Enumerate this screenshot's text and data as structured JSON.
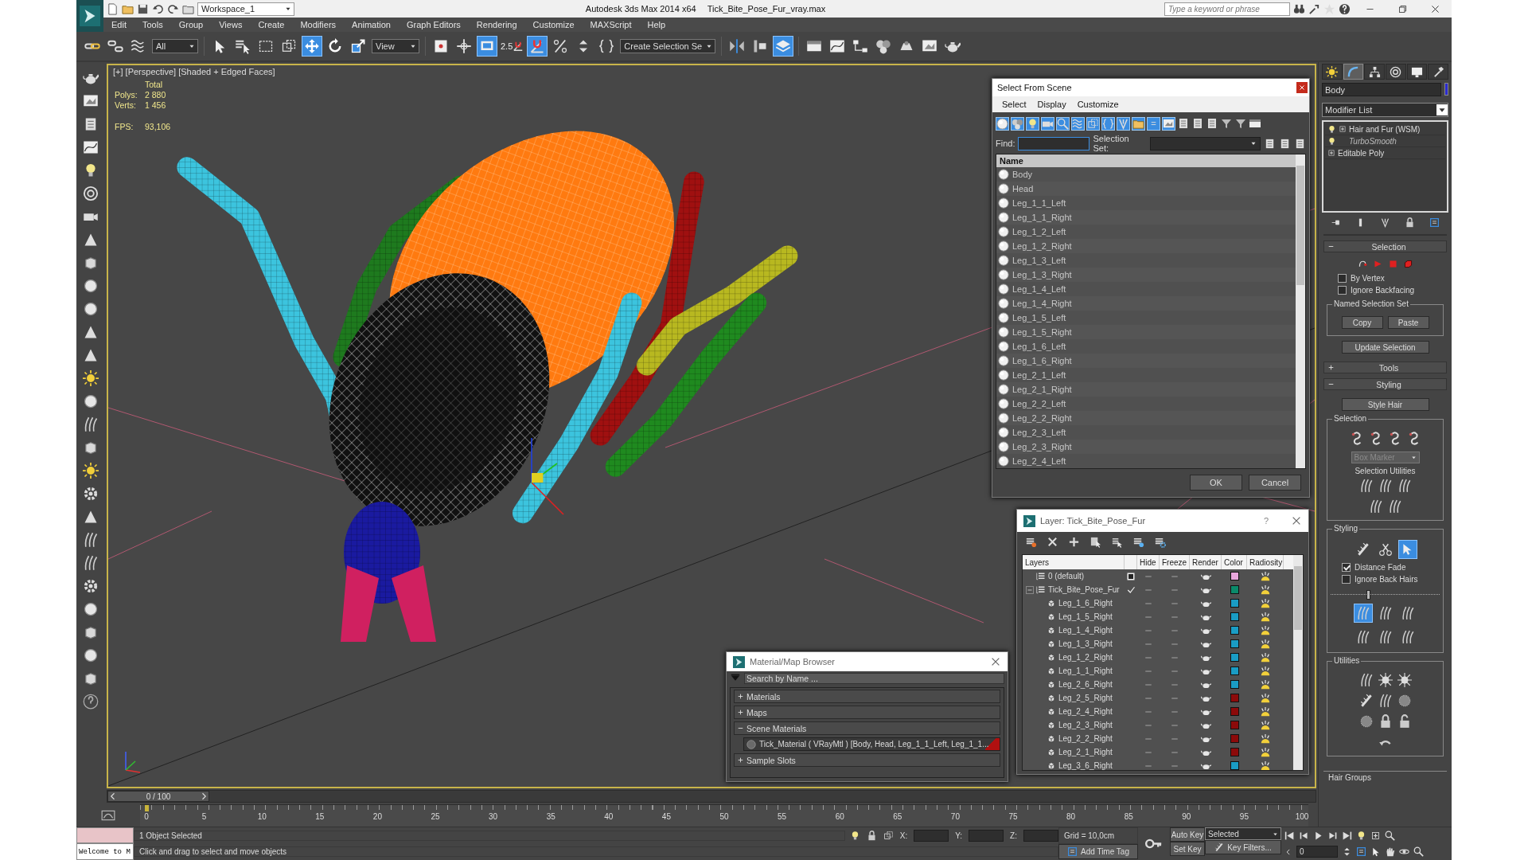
{
  "title_bar": {
    "workspace": "Workspace_1",
    "title": "Autodesk 3ds Max  2014 x64",
    "file": "Tick_Bite_Pose_Fur_vray.max",
    "search_placeholder": "Type a keyword or phrase"
  },
  "menu": [
    "Edit",
    "Tools",
    "Group",
    "Views",
    "Create",
    "Modifiers",
    "Animation",
    "Graph Editors",
    "Rendering",
    "Customize",
    "MAXScript",
    "Help"
  ],
  "main_toolbar": {
    "selection_filter": "All",
    "reference_coordinate_system": "View",
    "snap": "2.5",
    "named_selection_set": "Create Selection Se",
    "tools": [
      {
        "selected": false
      },
      {
        "selected": false
      },
      {
        "selected": false
      },
      {
        "selected": false
      },
      {
        "selected": false
      },
      {
        "selected": false
      },
      {
        "selected": false
      },
      {
        "selected": true
      },
      {
        "selected": false
      },
      {
        "selected": false
      },
      {
        "selected": false
      },
      {
        "selected": false
      },
      {
        "selected": true
      },
      {
        "selected": true
      },
      {
        "selected": false
      },
      {
        "selected": false
      },
      {
        "selected": false
      },
      {
        "selected": false
      },
      {
        "selected": false
      },
      {
        "selected": true
      },
      {
        "selected": false
      },
      {
        "selected": false
      },
      {
        "selected": false
      },
      {
        "selected": false
      },
      {
        "selected": false
      },
      {
        "selected": false
      },
      {
        "selected": false
      }
    ]
  },
  "viewport": {
    "label": "[+] [Perspective] [Shaded + Edged Faces]",
    "active": true,
    "stats_heading": "Total",
    "stats": [
      {
        "label": "Polys:",
        "value": "2 880"
      },
      {
        "label": "Verts:",
        "value": "1 456"
      }
    ],
    "fps_label": "FPS:",
    "fps": "93,106"
  },
  "select_dialog": {
    "title": "Select From Scene",
    "menu": [
      "Select",
      "Display",
      "Customize"
    ],
    "find_label": "Find:",
    "selection_set_label": "Selection Set:",
    "column": "Name",
    "items": [
      {
        "name": "Body",
        "selected": false
      },
      {
        "name": "Head",
        "selected": false
      },
      {
        "name": "Leg_1_1_Left",
        "selected": false
      },
      {
        "name": "Leg_1_1_Right",
        "selected": false
      },
      {
        "name": "Leg_1_2_Left",
        "selected": false
      },
      {
        "name": "Leg_1_2_Right",
        "selected": false
      },
      {
        "name": "Leg_1_3_Left",
        "selected": false
      },
      {
        "name": "Leg_1_3_Right",
        "selected": false
      },
      {
        "name": "Leg_1_4_Left",
        "selected": false
      },
      {
        "name": "Leg_1_4_Right",
        "selected": false
      },
      {
        "name": "Leg_1_5_Left",
        "selected": false
      },
      {
        "name": "Leg_1_5_Right",
        "selected": false
      },
      {
        "name": "Leg_1_6_Left",
        "selected": false
      },
      {
        "name": "Leg_1_6_Right",
        "selected": false
      },
      {
        "name": "Leg_2_1_Left",
        "selected": false
      },
      {
        "name": "Leg_2_1_Right",
        "selected": false
      },
      {
        "name": "Leg_2_2_Left",
        "selected": false
      },
      {
        "name": "Leg_2_2_Right",
        "selected": false
      },
      {
        "name": "Leg_2_3_Left",
        "selected": false
      },
      {
        "name": "Leg_2_3_Right",
        "selected": false
      },
      {
        "name": "Leg_2_4_Left",
        "selected": false
      }
    ],
    "buttons": [
      "OK",
      "Cancel"
    ]
  },
  "layer_dialog": {
    "title": "Layer: Tick_Bite_Pose_Fur",
    "help": "?",
    "columns": [
      "Layers",
      "Hide",
      "Freeze",
      "Render",
      "Color",
      "Radiosity"
    ],
    "layers": [
      {
        "name": "0 (default)",
        "kind": "layer",
        "current": false,
        "color": "#e8a6dc"
      },
      {
        "name": "Tick_Bite_Pose_Fur",
        "kind": "layer",
        "current": true,
        "expanded": true,
        "color": "#0b8a6a",
        "children": [
          {
            "name": "Leg_1_6_Right",
            "kind": "object",
            "color": "#1a9cc4"
          },
          {
            "name": "Leg_1_5_Right",
            "kind": "object",
            "color": "#1a9cc4"
          },
          {
            "name": "Leg_1_4_Right",
            "kind": "object",
            "color": "#1a9cc4"
          },
          {
            "name": "Leg_1_3_Right",
            "kind": "object",
            "color": "#1a9cc4"
          },
          {
            "name": "Leg_1_2_Right",
            "kind": "object",
            "color": "#1a9cc4"
          },
          {
            "name": "Leg_1_1_Right",
            "kind": "object",
            "color": "#1a9cc4"
          },
          {
            "name": "Leg_2_6_Right",
            "kind": "object",
            "color": "#1a9cc4"
          },
          {
            "name": "Leg_2_5_Right",
            "kind": "object",
            "color": "#8c0a0a"
          },
          {
            "name": "Leg_2_4_Right",
            "kind": "object",
            "color": "#8c0a0a"
          },
          {
            "name": "Leg_2_3_Right",
            "kind": "object",
            "color": "#8c0a0a"
          },
          {
            "name": "Leg_2_2_Right",
            "kind": "object",
            "color": "#8c0a0a"
          },
          {
            "name": "Leg_2_1_Right",
            "kind": "object",
            "color": "#8c0a0a"
          },
          {
            "name": "Leg_3_6_Right",
            "kind": "object",
            "color": "#1a9cc4"
          }
        ]
      }
    ]
  },
  "material_browser": {
    "title": "Material/Map Browser",
    "search_placeholder": "Search by Name ...",
    "groups": [
      {
        "label": "Materials",
        "expanded": false
      },
      {
        "label": "Maps",
        "expanded": false
      },
      {
        "label": "Scene Materials",
        "expanded": true,
        "items": [
          "Tick_Material  ( VRayMtl ) [Body, Head, Leg_1_1_Left, Leg_1_1..."
        ]
      },
      {
        "label": "Sample Slots",
        "expanded": false
      }
    ]
  },
  "command_panel": {
    "tabs": [
      {
        "selected": false
      },
      {
        "selected": true
      },
      {
        "selected": false
      },
      {
        "selected": false
      },
      {
        "selected": false
      },
      {
        "selected": false
      }
    ],
    "object_name": "Body",
    "modifier_list": "Modifier List",
    "stack": [
      {
        "label": "Hair and Fur (WSM)",
        "kind": "modifier",
        "expandable": true,
        "disabled_in_viewport": false
      },
      {
        "label": "TurboSmooth",
        "kind": "modifier",
        "expandable": false,
        "disabled_in_viewport": true
      },
      {
        "label": "Editable Poly",
        "kind": "base",
        "expandable": true,
        "disabled_in_viewport": false
      }
    ],
    "selection_rollout": {
      "title": "Selection",
      "expanded": true,
      "checkboxes": [
        {
          "label": "By Vertex",
          "checked": false
        },
        {
          "label": "Ignore Backfacing",
          "checked": false
        }
      ],
      "named_set_title": "Named Selection Set",
      "buttons": [
        "Copy",
        "Paste"
      ],
      "update_button": "Update Selection"
    },
    "tools_rollout": {
      "title": "Tools",
      "expanded": false
    },
    "styling_rollout": {
      "title": "Styling",
      "expanded": true,
      "style_button": "Style Hair",
      "selection_group": "Selection",
      "marker_dropdown": {
        "value": "Box Marker",
        "disabled": true
      },
      "utilities_label": "Selection Utilities",
      "styling_group": "Styling",
      "styling_tools": [
        {
          "selected": false
        },
        {
          "selected": false
        },
        {
          "selected": true
        }
      ],
      "checkboxes": [
        {
          "label": "Distance Fade",
          "checked": true
        },
        {
          "label": "Ignore Back Hairs",
          "checked": false
        }
      ],
      "falloff_slider": {
        "level": 0.35
      },
      "mode_tools": [
        {
          "selected": true
        },
        {
          "selected": false
        },
        {
          "selected": false
        },
        {
          "selected": false
        },
        {
          "selected": false
        },
        {
          "selected": false
        }
      ],
      "utilities_group": "Utilities"
    },
    "hair_groups_title": "Hair Groups"
  },
  "timeline": {
    "time_slider": {
      "label": "0 / 100",
      "level": 0
    },
    "ticks": [
      "0",
      "5",
      "10",
      "15",
      "20",
      "25",
      "30",
      "35",
      "40",
      "45",
      "50",
      "55",
      "60",
      "65",
      "70",
      "75",
      "80",
      "85",
      "90",
      "95",
      "100"
    ]
  },
  "status_bar": {
    "script_output": "Welcome to M",
    "selection_info": "1 Object Selected",
    "hint": "Click and drag to select and move objects",
    "coordinate_labels": [
      "X:",
      "Y:",
      "Z:"
    ],
    "grid": "Grid = 10,0cm",
    "add_time_tag": "Add Time Tag",
    "auto_key": "Auto Key",
    "set_key": "Set Key",
    "key_mode": "Selected",
    "key_filters": "Key Filters...",
    "frame": "0"
  }
}
